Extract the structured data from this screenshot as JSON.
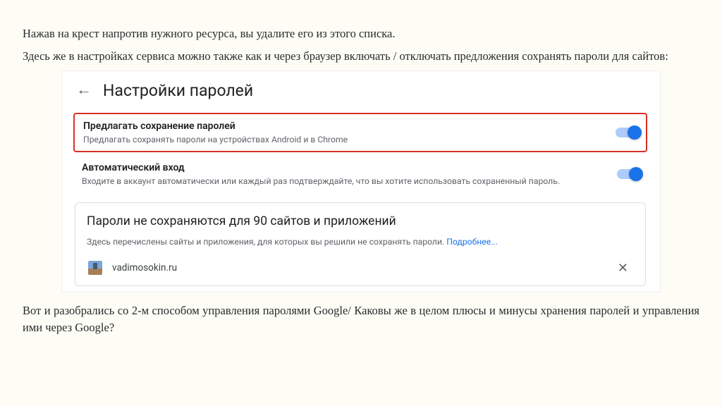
{
  "intro": {
    "p1": "Нажав на крест напротив нужного ресурса, вы удалите его из этого списка.",
    "p2": "Здесь же в настройках сервиса можно также как и через браузер включать / отключать предложения сохранять пароли для сайтов:"
  },
  "card": {
    "title": "Настройки паролей",
    "offer": {
      "title": "Предлагать сохранение паролей",
      "desc": "Предлагать сохранять пароли на устройствах Android и в Chrome"
    },
    "auto": {
      "title": "Автоматический вход",
      "desc": "Входите в аккаунт автоматически или каждый раз подтверждайте, что вы хотите использовать сохраненный пароль."
    },
    "blocked": {
      "title": "Пароли не сохраняются для 90 сайтов и приложений",
      "desc": "Здесь перечислены сайты и приложения, для которых вы решили не сохранять пароли. ",
      "more": "Подробнее...",
      "site": "vadimosokin.ru"
    }
  },
  "outro": "Вот и разобрались со 2-м способом управления паролями Google/ Каковы же в целом плюсы и минусы хранения паролей и управления ими через Google?"
}
